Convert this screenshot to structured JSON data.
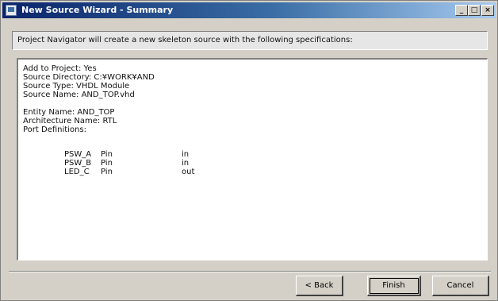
{
  "window": {
    "title": "New Source Wizard - Summary",
    "controls": {
      "minimize": "_",
      "maximize": "□",
      "close": "×"
    }
  },
  "header": {
    "text": "Project Navigator will create a new skeleton source with the following specifications:"
  },
  "summary": {
    "lines": [
      "Add to Project: Yes",
      "Source Directory: C:¥WORK¥AND",
      "Source Type: VHDL Module",
      "Source Name: AND_TOP.vhd",
      "",
      "Entity Name: AND_TOP",
      "Architecture Name: RTL",
      "Port Definitions:"
    ],
    "ports": [
      {
        "name": "PSW_A",
        "type": "Pin",
        "direction": "in"
      },
      {
        "name": "PSW_B",
        "type": "Pin",
        "direction": "in"
      },
      {
        "name": "LED_C",
        "type": "Pin",
        "direction": "out"
      }
    ]
  },
  "buttons": {
    "back": "< Back",
    "finish": "Finish",
    "cancel": "Cancel"
  }
}
